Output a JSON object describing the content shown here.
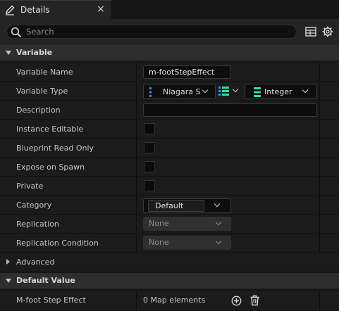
{
  "tab": {
    "title": "Details",
    "close": "×",
    "icon": "edit-pencil-icon"
  },
  "search": {
    "placeholder": "Search",
    "value": ""
  },
  "toolbar": {
    "table_icon": "table-view-icon",
    "settings_icon": "gear-icon"
  },
  "sections": {
    "variable": "Variable",
    "advanced": "Advanced",
    "default_value": "Default Value"
  },
  "rows": {
    "variable_name": {
      "label": "Variable Name",
      "value": "m-footStepEffect"
    },
    "variable_type": {
      "label": "Variable Type",
      "type_value": "Niagara S",
      "container_value": "Integer"
    },
    "description": {
      "label": "Description",
      "value": ""
    },
    "instance_editable": {
      "label": "Instance Editable",
      "checked": false
    },
    "blueprint_read_only": {
      "label": "Blueprint Read Only",
      "checked": false
    },
    "expose_on_spawn": {
      "label": "Expose on Spawn",
      "checked": false
    },
    "private": {
      "label": "Private",
      "checked": false
    },
    "category": {
      "label": "Category",
      "value": "Default"
    },
    "replication": {
      "label": "Replication",
      "value": "None"
    },
    "replication_condition": {
      "label": "Replication Condition",
      "value": "None"
    },
    "m_foot_step_effect": {
      "label": "M-foot Step Effect",
      "value": "0 Map elements"
    }
  },
  "colors": {
    "niagara_type": "#3d8df0",
    "integer_type": "#2fe0a0",
    "panel_bg": "#1b1b1b",
    "section_bg": "#2e2e2e"
  }
}
